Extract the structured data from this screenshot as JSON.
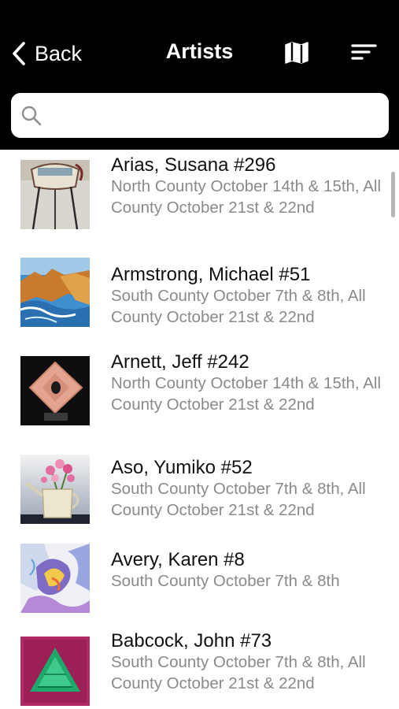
{
  "nav": {
    "back_label": "Back",
    "title": "Artists",
    "map_icon": "map-icon",
    "sort_icon": "sort-icon"
  },
  "search": {
    "value": "",
    "placeholder": ""
  },
  "artists": [
    {
      "name": "Arias, Susana #296",
      "dates": "North County October 14th & 15th, All County October 21st & 22nd",
      "thumb": "sculpture-stand"
    },
    {
      "name": "Armstrong, Michael #51",
      "dates": "South County October 7th & 8th, All County October 21st & 22nd",
      "thumb": "coastal-painting"
    },
    {
      "name": "Arnett, Jeff #242",
      "dates": "North County October 14th & 15th, All County October 21st & 22nd",
      "thumb": "stone-sculpture"
    },
    {
      "name": "Aso, Yumiko #52",
      "dates": "South County October 7th & 8th, All County October 21st & 22nd",
      "thumb": "watering-can-flowers"
    },
    {
      "name": "Avery, Karen #8",
      "dates": "South County October 7th & 8th",
      "thumb": "abstract-painting"
    },
    {
      "name": "Babcock, John #73",
      "dates": "South County October 7th & 8th, All County October 21st & 22nd",
      "thumb": "triangle-textile"
    }
  ],
  "colors": {
    "nav_background": "#000000",
    "subtitle": "#8a8a8a",
    "title": "#111111"
  }
}
